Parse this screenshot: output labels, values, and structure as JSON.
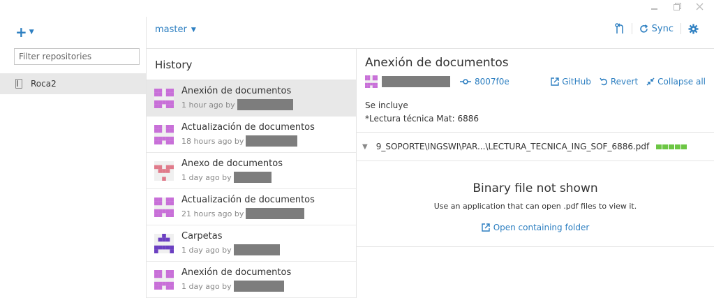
{
  "window": {
    "minimize_label": "minimize",
    "restore_label": "restore",
    "close_label": "close"
  },
  "sidebar": {
    "add_label": "+",
    "filter_placeholder": "Filter repositories",
    "repos": [
      {
        "name": "Roca2"
      }
    ]
  },
  "topbar": {
    "branch": "master",
    "sync_label": "Sync"
  },
  "history": {
    "title": "History",
    "commits": [
      {
        "title": "Anexión de documentos",
        "time": "1 hour ago by",
        "avatar_color": "#c86fd8",
        "selected": true
      },
      {
        "title": "Actualización de documentos",
        "time": "18 hours ago by",
        "avatar_color": "#c86fd8"
      },
      {
        "title": "Anexo de documentos",
        "time": "1 day ago by",
        "avatar_color": "#e07a8a"
      },
      {
        "title": "Actualización de documentos",
        "time": "21 hours ago by",
        "avatar_color": "#c86fd8"
      },
      {
        "title": "Carpetas",
        "time": "1 day ago by",
        "avatar_color": "#6b3fc1"
      },
      {
        "title": "Anexión de documentos",
        "time": "1 day ago by",
        "avatar_color": "#c86fd8"
      }
    ]
  },
  "detail": {
    "title": "Anexión de documentos",
    "sha": "8007f0e",
    "github_label": "GitHub",
    "revert_label": "Revert",
    "collapse_label": "Collapse all",
    "description_line1": "Se incluye",
    "description_line2": "*Lectura técnica Mat: 6886",
    "file_path": "9_SOPORTE\\INGSWI\\PAR...\\LECTURA_TECNICA_ING_SOF_6886.pdf",
    "binary_title": "Binary file not shown",
    "binary_sub": "Use an application that can open .pdf files to view it.",
    "open_folder_label": "Open containing folder"
  },
  "colors": {
    "accent": "#2d7fc1",
    "selected_bg": "#e8e8e8",
    "diff_add": "#6cc644"
  }
}
